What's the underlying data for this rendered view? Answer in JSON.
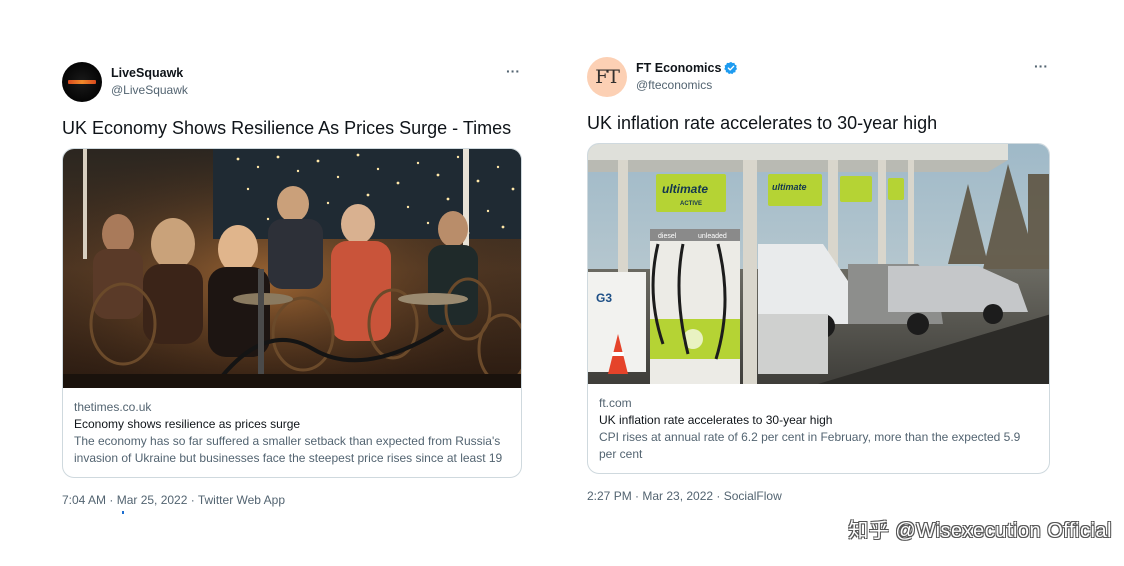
{
  "tweets": [
    {
      "user": {
        "name": "LiveSquawk",
        "handle": "@LiveSquawk",
        "verified": false,
        "avatar_icon": "livesquawk-logo-icon"
      },
      "text": "UK Economy Shows Resilience As Prices Surge - Times",
      "card": {
        "image": "outdoor-cafe-photo",
        "domain": "thetimes.co.uk",
        "title": "Economy shows resilience as prices surge",
        "description": "The economy has so far suffered a smaller setback than expected from Russia's invasion of Ukraine but businesses face the steepest price rises since at least 19"
      },
      "footer": "7:04 AM · Mar 25, 2022 · Twitter Web App"
    },
    {
      "user": {
        "name": "FT Economics",
        "handle": "@fteconomics",
        "verified": true,
        "avatar_text": "FT"
      },
      "text": "UK inflation rate accelerates to 30-year high",
      "card": {
        "image": "petrol-station-photo",
        "domain": "ft.com",
        "title": "UK inflation rate accelerates to 30-year high",
        "description": "CPI rises at annual rate of 6.2 per cent in February, more than the expected 5.9 per cent"
      },
      "footer": "2:27 PM · Mar 23, 2022 · SocialFlow"
    }
  ],
  "pump_labels": {
    "brand": "ultimate",
    "sub": "ACTIVE",
    "diesel": "diesel",
    "unleaded": "unleaded"
  },
  "watermark": "知乎 @Wisexecution Official",
  "colors": {
    "text_primary": "#0f1419",
    "text_secondary": "#536471",
    "verified_blue": "#1d9bf0",
    "card_border": "#cfd9de",
    "ft_avatar_bg": "#fcd0b4"
  },
  "icons": {
    "more": "more-horizontal-icon",
    "verified": "verified-badge-icon"
  }
}
